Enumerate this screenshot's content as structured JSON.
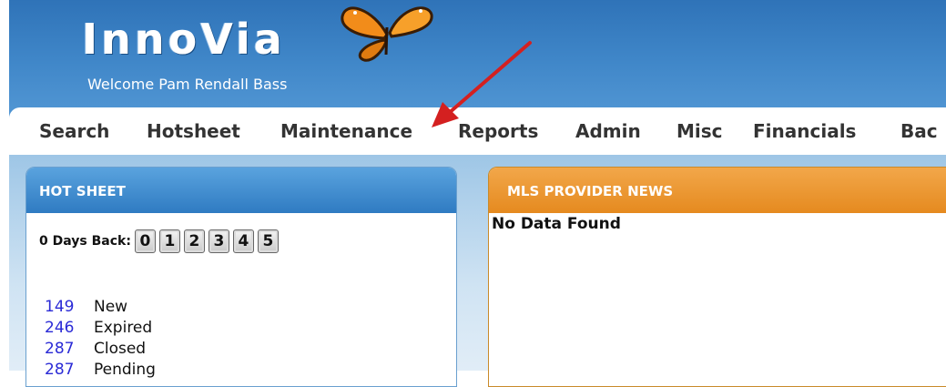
{
  "header": {
    "logo": "InnoVia",
    "welcome": "Welcome Pam Rendall Bass",
    "accent": "#3f86c8"
  },
  "nav": {
    "items": [
      "Search",
      "Hotsheet",
      "Maintenance",
      "Reports",
      "Admin",
      "Misc",
      "Financials",
      "Bac"
    ]
  },
  "hotsheet": {
    "title": "HOT SHEET",
    "days_label": "0 Days Back:",
    "day_buttons": [
      "0",
      "1",
      "2",
      "3",
      "4",
      "5"
    ],
    "rows": [
      {
        "count": "149",
        "label": "New"
      },
      {
        "count": "246",
        "label": "Expired"
      },
      {
        "count": "287",
        "label": "Closed"
      },
      {
        "count": "287",
        "label": "Pending"
      }
    ]
  },
  "news": {
    "title": "MLS PROVIDER NEWS",
    "empty_text": "No Data Found",
    "accent": "#e8952a"
  },
  "icons": [
    "butterfly-logo-icon",
    "red-arrow-annotation"
  ]
}
